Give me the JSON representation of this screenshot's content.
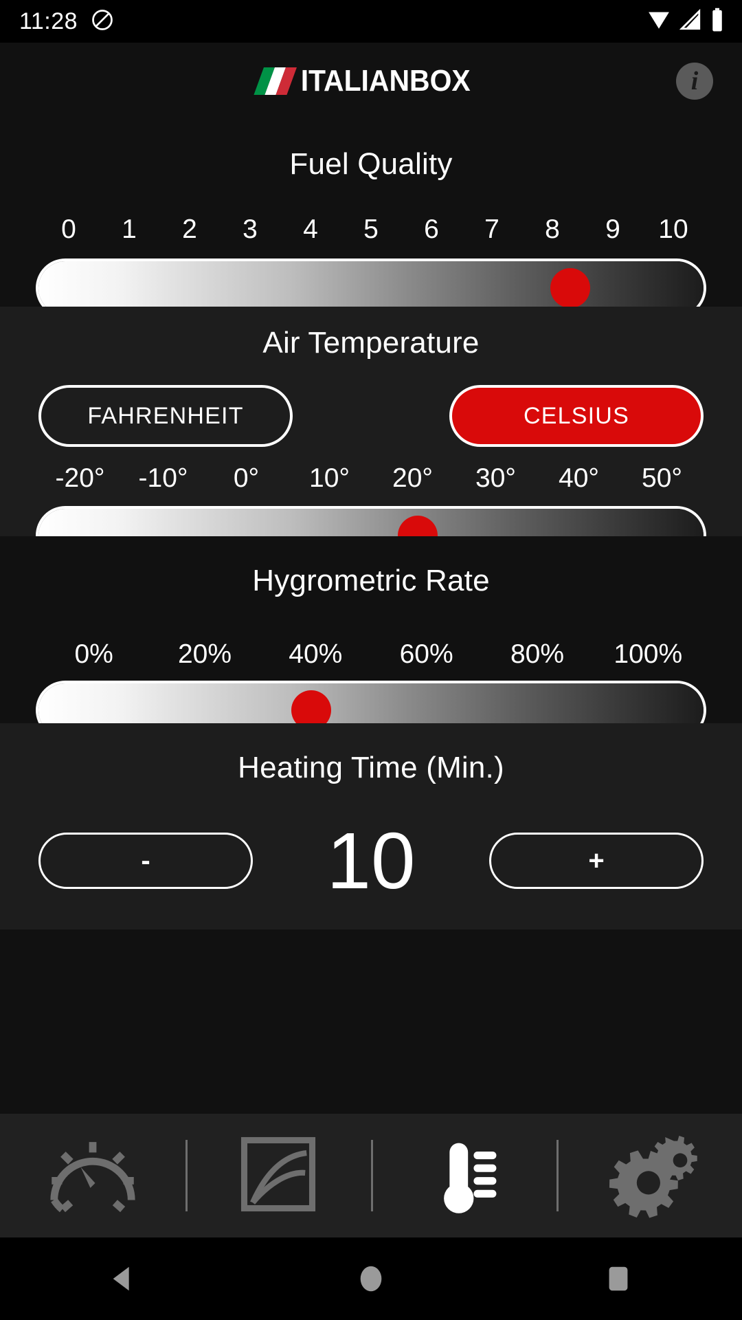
{
  "statusbar": {
    "time": "11:28",
    "icons": [
      "do-not-disturb-icon",
      "wifi-icon",
      "cellular-signal-icon",
      "battery-icon"
    ]
  },
  "header": {
    "brand_name": "ITALIANBOX",
    "flag_colors": [
      "#009246",
      "#ffffff",
      "#ce2b37"
    ],
    "info_glyph": "i",
    "info_label": "info-button"
  },
  "colors": {
    "accent_red": "#d90a0a",
    "background": "#111111",
    "panel_alt": "#1d1d1d",
    "tabbar": "#212121",
    "text": "#ffffff",
    "icon_inactive": "#6e6e6e",
    "icon_active": "#ffffff"
  },
  "fuel": {
    "title": "Fuel Quality",
    "ticks": [
      "0",
      "1",
      "2",
      "3",
      "4",
      "5",
      "6",
      "7",
      "8",
      "9",
      "10"
    ],
    "value": 8,
    "min": 0,
    "max": 10,
    "thumb_percent": 80
  },
  "temperature": {
    "title": "Air Temperature",
    "units": [
      {
        "label": "FAHRENHEIT",
        "selected": false
      },
      {
        "label": "CELSIUS",
        "selected": true
      }
    ],
    "ticks": [
      "-20°",
      "-10°",
      "0°",
      "10°",
      "20°",
      "30°",
      "40°",
      "50°"
    ],
    "value": "20°",
    "min": "-20°",
    "max": "50°",
    "thumb_percent": 57
  },
  "hygrometric": {
    "title": "Hygrometric Rate",
    "ticks": [
      "0%",
      "20%",
      "40%",
      "60%",
      "80%",
      "100%"
    ],
    "value": "40%",
    "min": "0%",
    "max": "100%",
    "thumb_percent": 41
  },
  "heating": {
    "title": "Heating Time (Min.)",
    "decrement_label": "-",
    "increment_label": "+",
    "value": "10"
  },
  "tabbar": {
    "items": [
      {
        "icon": "gauge-icon",
        "active": false
      },
      {
        "icon": "chart-icon",
        "active": false
      },
      {
        "icon": "thermometer-icon",
        "active": true
      },
      {
        "icon": "gears-icon",
        "active": false
      }
    ]
  },
  "navbar": {
    "items": [
      {
        "icon": "back-triangle-icon"
      },
      {
        "icon": "home-circle-icon"
      },
      {
        "icon": "recents-square-icon"
      }
    ]
  }
}
